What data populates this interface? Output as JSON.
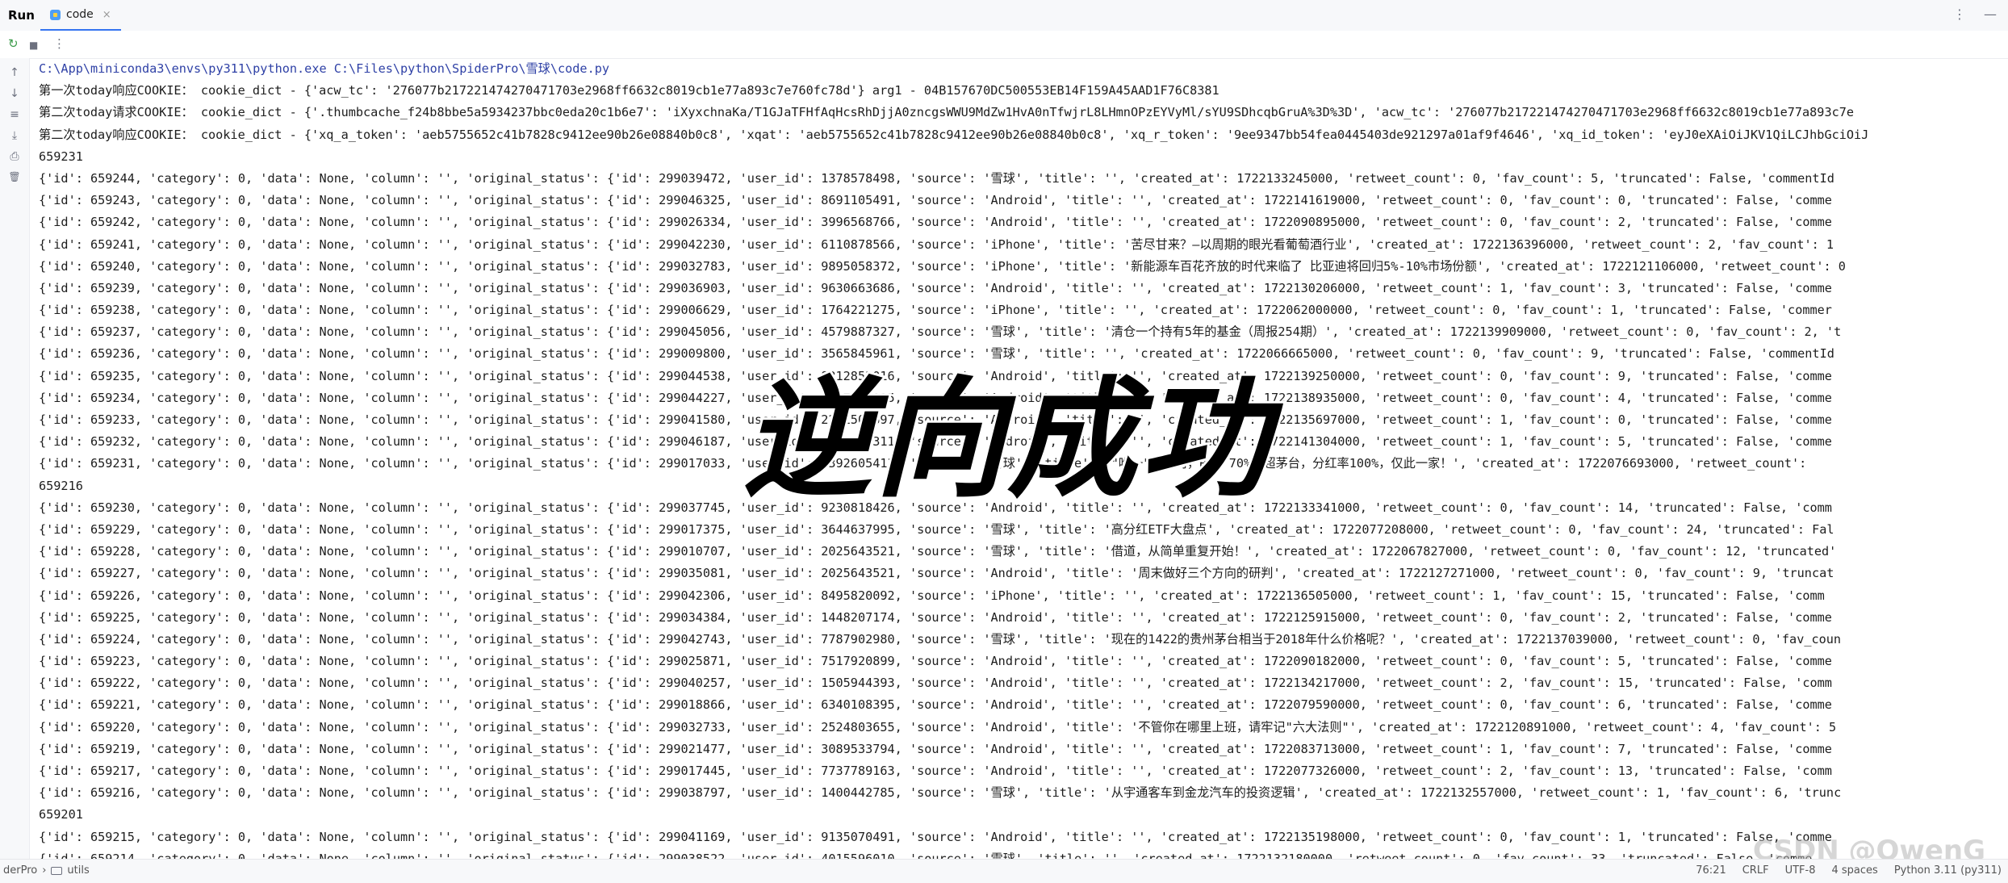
{
  "window": {
    "run_label": "Run",
    "tab_label": "code",
    "tab_close": "×",
    "more_glyph": "⋮",
    "minimize_glyph": "—"
  },
  "toolbar": {
    "rerun_icon": "↻",
    "stop_icon": "■",
    "menu_icon": "⋮"
  },
  "gutter": {
    "up_icon": "↑",
    "down_icon": "↓",
    "wrap_icon": "≡",
    "scroll_end_icon": "⤓",
    "print_icon": "⎙",
    "clear_icon": "🗑"
  },
  "console_lines": [
    "C:\\App\\miniconda3\\envs\\py311\\python.exe C:\\Files\\python\\SpiderPro\\雪球\\code.py",
    "第一次today响应COOKIE： cookie_dict - {'acw_tc': '276077b217221474270471703e2968ff6632c8019cb1e77a893c7e760fc78d'} arg1 - 04B157670DC500553EB14F159A45AAD1F76C8381",
    "第二次today请求COOKIE： cookie_dict - {'.thumbcache_f24b8bbe5a5934237bbc0eda20c1b6e7': 'iXyxchnaKa/T1GJaTFHfAqHcsRhDjjA0zncgsWWU9MdZw1HvA0nTfwjrL8LHmnOPzEYVyMl/sYU9SDhcqbGruA%3D%3D', 'acw_tc': '276077b217221474270471703e2968ff6632c8019cb1e77a893c7e",
    "第二次today响应COOKIE： cookie_dict - {'xq_a_token': 'aeb5755652c41b7828c9412ee90b26e08840b0c8', 'xqat': 'aeb5755652c41b7828c9412ee90b26e08840b0c8', 'xq_r_token': '9ee9347bb54fea0445403de921297a01af9f4646', 'xq_id_token': 'eyJ0eXAiOiJKV1QiLCJhbGciOiJ",
    "659231",
    "{'id': 659244, 'category': 0, 'data': None, 'column': '', 'original_status': {'id': 299039472, 'user_id': 1378578498, 'source': '雪球', 'title': '', 'created_at': 1722133245000, 'retweet_count': 0, 'fav_count': 5, 'truncated': False, 'commentId",
    "{'id': 659243, 'category': 0, 'data': None, 'column': '', 'original_status': {'id': 299046325, 'user_id': 8691105491, 'source': 'Android', 'title': '', 'created_at': 1722141619000, 'retweet_count': 0, 'fav_count': 0, 'truncated': False, 'comme",
    "{'id': 659242, 'category': 0, 'data': None, 'column': '', 'original_status': {'id': 299026334, 'user_id': 3996568766, 'source': 'Android', 'title': '', 'created_at': 1722090895000, 'retweet_count': 0, 'fav_count': 2, 'truncated': False, 'comme",
    "{'id': 659241, 'category': 0, 'data': None, 'column': '', 'original_status': {'id': 299042230, 'user_id': 6110878566, 'source': 'iPhone', 'title': '苦尽甘来？—以周期的眼光看葡萄酒行业', 'created_at': 1722136396000, 'retweet_count': 2, 'fav_count': 1",
    "{'id': 659240, 'category': 0, 'data': None, 'column': '', 'original_status': {'id': 299032783, 'user_id': 9895058372, 'source': 'iPhone', 'title': '新能源车百花齐放的时代来临了 比亚迪将回归5%-10%市场份额', 'created_at': 1722121106000, 'retweet_count': 0",
    "{'id': 659239, 'category': 0, 'data': None, 'column': '', 'original_status': {'id': 299036903, 'user_id': 9630663686, 'source': 'Android', 'title': '', 'created_at': 1722130206000, 'retweet_count': 1, 'fav_count': 3, 'truncated': False, 'comme",
    "{'id': 659238, 'category': 0, 'data': None, 'column': '', 'original_status': {'id': 299006629, 'user_id': 1764221275, 'source': 'iPhone', 'title': '', 'created_at': 1722062000000, 'retweet_count': 0, 'fav_count': 1, 'truncated': False, 'commer",
    "{'id': 659237, 'category': 0, 'data': None, 'column': '', 'original_status': {'id': 299045056, 'user_id': 4579887327, 'source': '雪球', 'title': '清仓一个持有5年的基金（周报254期）', 'created_at': 1722139909000, 'retweet_count': 0, 'fav_count': 2, 't",
    "{'id': 659236, 'category': 0, 'data': None, 'column': '', 'original_status': {'id': 299009800, 'user_id': 3565845961, 'source': '雪球', 'title': '', 'created_at': 1722066665000, 'retweet_count': 0, 'fav_count': 9, 'truncated': False, 'commentId",
    "{'id': 659235, 'category': 0, 'data': None, 'column': '', 'original_status': {'id': 299044538, 'user_id': 8212853016, 'source': 'Android', 'title': '', 'created_at': 1722139250000, 'retweet_count': 0, 'fav_count': 9, 'truncated': False, 'comme",
    "{'id': 659234, 'category': 0, 'data': None, 'column': '', 'original_status': {'id': 299044227, 'user_id': 5537481025, 'source': 'Android', 'title': '', 'created_at': 1722138935000, 'retweet_count': 0, 'fav_count': 4, 'truncated': False, 'comme",
    "{'id': 659233, 'category': 0, 'data': None, 'column': '', 'original_status': {'id': 299041580, 'user_id': 2231506697, 'source': 'Android', 'title': '', 'created_at': 1722135697000, 'retweet_count': 1, 'fav_count': 0, 'truncated': False, 'comme",
    "{'id': 659232, 'category': 0, 'data': None, 'column': '', 'original_status': {'id': 299046187, 'user_id': 6402587311, 'source': 'Android', 'title': '', 'created_at': 1722141304000, 'retweet_count': 1, 'fav_count': 5, 'truncated': False, 'comme",
    "{'id': 659231, 'category': 0, 'data': None, 'column': '', 'original_status': {'id': 299017033, 'user_id': 3392605413, 'source': '雪球', 'title': '\"唯一\"的公司，ROE 70%远超茅台，分红率100%，仅此一家！', 'created_at': 1722076693000, 'retweet_count': ",
    "659216",
    "{'id': 659230, 'category': 0, 'data': None, 'column': '', 'original_status': {'id': 299037745, 'user_id': 9230818426, 'source': 'Android', 'title': '', 'created_at': 1722133341000, 'retweet_count': 0, 'fav_count': 14, 'truncated': False, 'comm",
    "{'id': 659229, 'category': 0, 'data': None, 'column': '', 'original_status': {'id': 299017375, 'user_id': 3644637995, 'source': '雪球', 'title': '高分红ETF大盘点', 'created_at': 1722077208000, 'retweet_count': 0, 'fav_count': 24, 'truncated': Fal",
    "{'id': 659228, 'category': 0, 'data': None, 'column': '', 'original_status': {'id': 299010707, 'user_id': 2025643521, 'source': '雪球', 'title': '借道，从简单重复开始！', 'created_at': 1722067827000, 'retweet_count': 0, 'fav_count': 12, 'truncated'",
    "{'id': 659227, 'category': 0, 'data': None, 'column': '', 'original_status': {'id': 299035081, 'user_id': 2025643521, 'source': 'Android', 'title': '周末做好三个方向的研判', 'created_at': 1722127271000, 'retweet_count': 0, 'fav_count': 9, 'truncat",
    "{'id': 659226, 'category': 0, 'data': None, 'column': '', 'original_status': {'id': 299042306, 'user_id': 8495820092, 'source': 'iPhone', 'title': '', 'created_at': 1722136505000, 'retweet_count': 1, 'fav_count': 15, 'truncated': False, 'comm",
    "{'id': 659225, 'category': 0, 'data': None, 'column': '', 'original_status': {'id': 299034384, 'user_id': 1448207174, 'source': 'Android', 'title': '', 'created_at': 1722125915000, 'retweet_count': 0, 'fav_count': 2, 'truncated': False, 'comme",
    "{'id': 659224, 'category': 0, 'data': None, 'column': '', 'original_status': {'id': 299042743, 'user_id': 7787902980, 'source': '雪球', 'title': '现在的1422的贵州茅台相当于2018年什么价格呢？', 'created_at': 1722137039000, 'retweet_count': 0, 'fav_coun",
    "{'id': 659223, 'category': 0, 'data': None, 'column': '', 'original_status': {'id': 299025871, 'user_id': 7517920899, 'source': 'Android', 'title': '', 'created_at': 1722090182000, 'retweet_count': 0, 'fav_count': 5, 'truncated': False, 'comme",
    "{'id': 659222, 'category': 0, 'data': None, 'column': '', 'original_status': {'id': 299040257, 'user_id': 1505944393, 'source': 'Android', 'title': '', 'created_at': 1722134217000, 'retweet_count': 2, 'fav_count': 15, 'truncated': False, 'comm",
    "{'id': 659221, 'category': 0, 'data': None, 'column': '', 'original_status': {'id': 299018866, 'user_id': 6340108395, 'source': 'Android', 'title': '', 'created_at': 1722079590000, 'retweet_count': 0, 'fav_count': 6, 'truncated': False, 'comme",
    "{'id': 659220, 'category': 0, 'data': None, 'column': '', 'original_status': {'id': 299032733, 'user_id': 2524803655, 'source': 'Android', 'title': '不管你在哪里上班，请牢记\"六大法则\"', 'created_at': 1722120891000, 'retweet_count': 4, 'fav_count': 5",
    "{'id': 659219, 'category': 0, 'data': None, 'column': '', 'original_status': {'id': 299021477, 'user_id': 3089533794, 'source': 'Android', 'title': '', 'created_at': 1722083713000, 'retweet_count': 1, 'fav_count': 7, 'truncated': False, 'comme",
    "{'id': 659217, 'category': 0, 'data': None, 'column': '', 'original_status': {'id': 299017445, 'user_id': 7737789163, 'source': 'Android', 'title': '', 'created_at': 1722077326000, 'retweet_count': 2, 'fav_count': 13, 'truncated': False, 'comm",
    "{'id': 659216, 'category': 0, 'data': None, 'column': '', 'original_status': {'id': 299038797, 'user_id': 1400442785, 'source': '雪球', 'title': '从宇通客车到金龙汽车的投资逻辑', 'created_at': 1722132557000, 'retweet_count': 1, 'fav_count': 6, 'trunc",
    "659201",
    "{'id': 659215, 'category': 0, 'data': None, 'column': '', 'original_status': {'id': 299041169, 'user_id': 9135070491, 'source': 'Android', 'title': '', 'created_at': 1722135198000, 'retweet_count': 0, 'fav_count': 1, 'truncated': False, 'comme",
    "{'id': 659214, 'category': 0, 'data': None, 'column': '', 'original_status': {'id': 299038522, 'user_id': 4015596010, 'source': '雪球', 'title': '', 'created_at': 1722132180000, 'retweet_count': 0, 'fav_count': 33, 'truncated': False, 'comme"
  ],
  "overlay_text": "逆向成功",
  "watermark_text": "CSDN @OwenG",
  "statusbar": {
    "project": "derPro",
    "separator": "›",
    "folder": "utils",
    "position": "76:21",
    "line_ending": "CRLF",
    "encoding": "UTF-8",
    "indent": "4 spaces",
    "interpreter": "Python 3.11 (py311)"
  }
}
